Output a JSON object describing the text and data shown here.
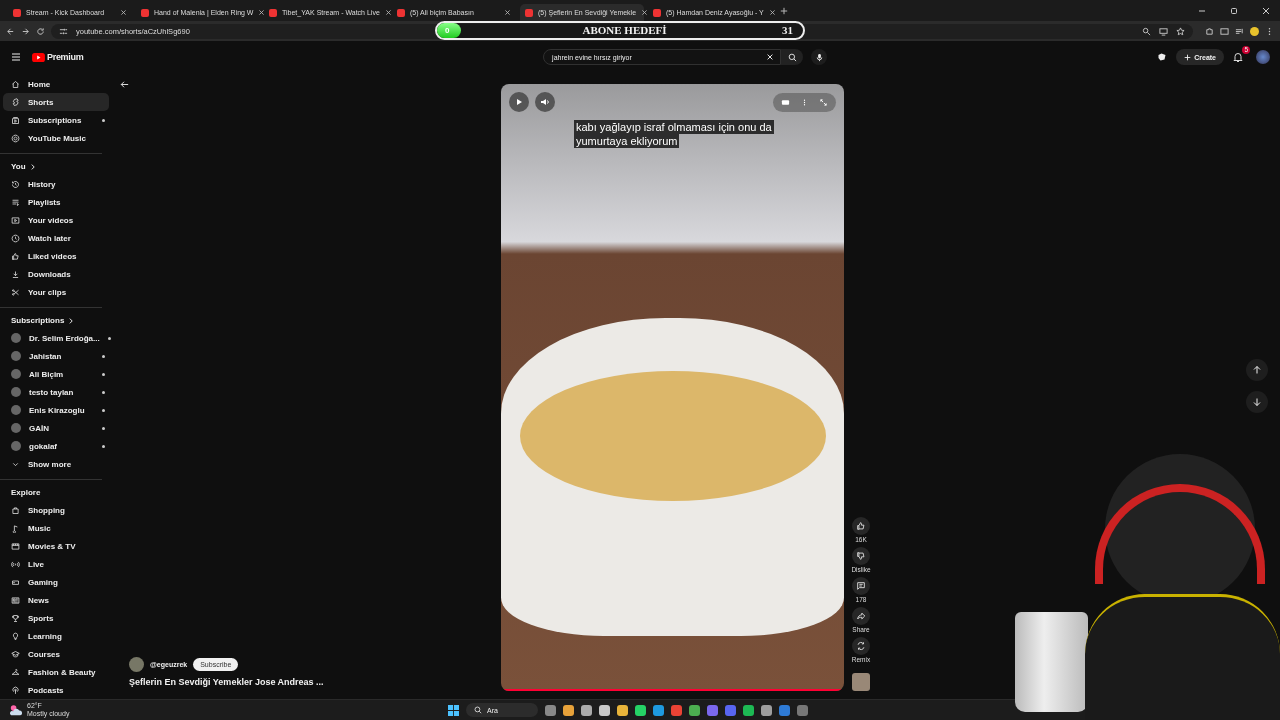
{
  "browser": {
    "tabs": [
      {
        "title": "Stream - Kick Dashboard",
        "selected": false
      },
      {
        "title": "Hand of Malenia | Elden Ring W",
        "selected": false
      },
      {
        "title": "Tibet_YAK Stream - Watch Live",
        "selected": false
      },
      {
        "title": "(5) Ali biçim Babasın",
        "selected": false
      },
      {
        "title": "(5) Şeflerin En Sevdiği Yemekle",
        "selected": true
      },
      {
        "title": "(5) Hamdan Deniz Ayasoğlu - Y",
        "selected": false
      }
    ],
    "url": "youtube.com/shorts/aCzUhlSg690"
  },
  "goal_overlay": {
    "current": "0",
    "title": "ABONE HEDEFİ",
    "target": "31",
    "level": 0
  },
  "header": {
    "logo": "Premium",
    "search": {
      "value": "jahrein evine hırsız giriyor"
    },
    "create": "Create",
    "notifications": "5"
  },
  "sidebar": {
    "main": [
      {
        "label": "Home",
        "selected": false,
        "dot": false
      },
      {
        "label": "Shorts",
        "selected": true,
        "dot": false
      },
      {
        "label": "Subscriptions",
        "selected": false,
        "dot": true
      },
      {
        "label": "YouTube Music",
        "selected": false,
        "dot": false
      }
    ],
    "you": {
      "title": "You",
      "items": [
        "History",
        "Playlists",
        "Your videos",
        "Watch later",
        "Liked videos",
        "Downloads",
        "Your clips"
      ]
    },
    "subscriptions": {
      "title": "Subscriptions",
      "channels": [
        {
          "name": "Dr. Selim Erdoğa...",
          "dot": true
        },
        {
          "name": "Jahistan",
          "dot": true
        },
        {
          "name": "Ali Biçim",
          "dot": true
        },
        {
          "name": "testo taylan",
          "dot": true
        },
        {
          "name": "Enis Kirazoglu",
          "dot": true
        },
        {
          "name": "GAİN",
          "dot": true
        },
        {
          "name": "gokalaf",
          "dot": true
        }
      ],
      "show_more": "Show more"
    },
    "explore": {
      "title": "Explore",
      "items": [
        "Shopping",
        "Music",
        "Movies & TV",
        "Live",
        "Gaming",
        "News",
        "Sports",
        "Learning",
        "Courses",
        "Fashion & Beauty",
        "Podcasts"
      ]
    }
  },
  "short": {
    "caption": [
      "kabı yağlayıp israf olmaması için onu da",
      "yumurtaya ekliyorum"
    ],
    "channel": "@egeuzrek",
    "subscribe": "Subscribe",
    "title": "Şeflerin En Sevdiği Yemekler Jose Andreas ...",
    "actions": [
      "16K",
      "Dislike",
      "178",
      "Share",
      "Remix"
    ]
  },
  "taskbar": {
    "temperature": "62°F",
    "weather": "Mostly cloudy",
    "search": "Ara"
  }
}
